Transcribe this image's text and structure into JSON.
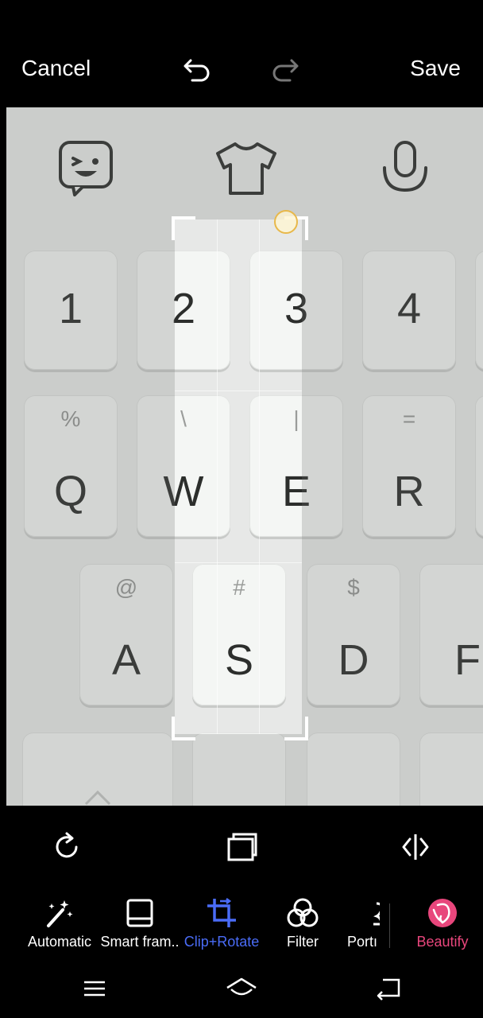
{
  "top_bar": {
    "cancel_label": "Cancel",
    "save_label": "Save",
    "undo_icon": "undo-icon",
    "redo_icon": "redo-icon"
  },
  "image": {
    "top_icons": [
      "emoji-sticker-icon",
      "tshirt-icon",
      "microphone-icon"
    ],
    "keys_row1": [
      "1",
      "2",
      "3",
      "4"
    ],
    "keys_row2": [
      {
        "main": "Q",
        "sub": "%"
      },
      {
        "main": "W",
        "sub": "\\"
      },
      {
        "main": "E",
        "sub": "|"
      },
      {
        "main": "R",
        "sub": "="
      }
    ],
    "keys_row3": [
      {
        "main": "A",
        "sub": "@"
      },
      {
        "main": "S",
        "sub": "#"
      },
      {
        "main": "D",
        "sub": "$"
      },
      {
        "main": "F",
        "sub": ""
      }
    ]
  },
  "crop_tools": {
    "rotate_icon": "rotate-icon",
    "aspect_icon": "aspect-ratio-icon",
    "flip_icon": "flip-horizontal-icon"
  },
  "edit_menu": [
    {
      "label": "Automatic",
      "icon": "magic-wand-icon",
      "active": false
    },
    {
      "label": "Smart fram..",
      "icon": "frame-icon",
      "active": false
    },
    {
      "label": "Clip+Rotate",
      "icon": "crop-icon",
      "active": true
    },
    {
      "label": "Filter",
      "icon": "filter-icon",
      "active": false
    },
    {
      "label": "Portı",
      "icon": "portrait-icon",
      "active": false
    },
    {
      "label": "Beautify",
      "icon": "beautify-face-icon",
      "active": false
    }
  ],
  "colors": {
    "active_tool": "#4a6cf7",
    "beautify": "#e8467c",
    "background": "#000000"
  },
  "system_nav": [
    "menu-icon",
    "home-icon",
    "back-icon"
  ]
}
